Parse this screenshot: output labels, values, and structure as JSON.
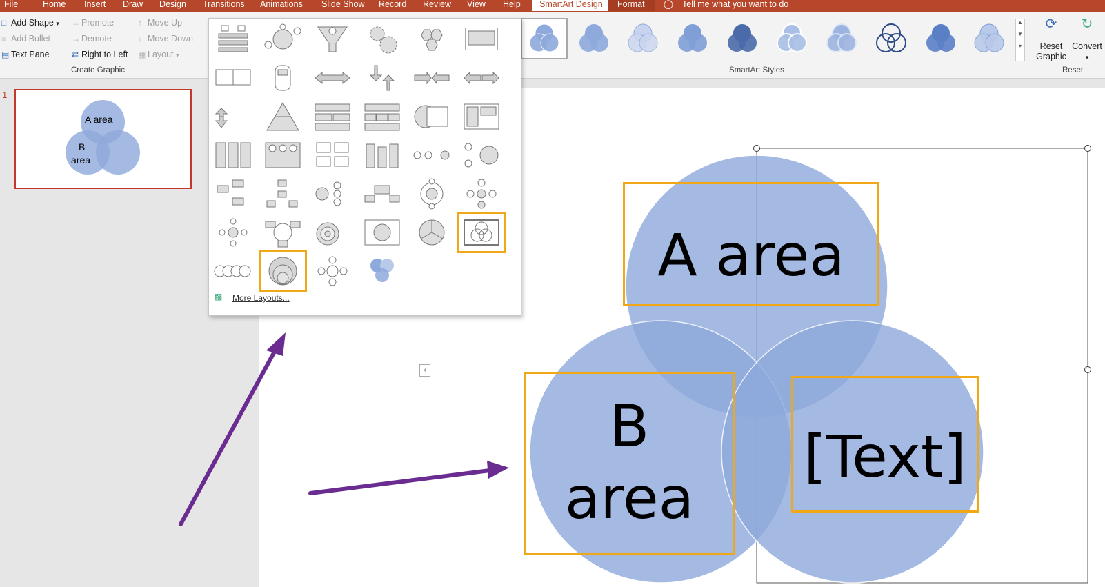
{
  "tabs": [
    "File",
    "Home",
    "Insert",
    "Draw",
    "Design",
    "Transitions",
    "Animations",
    "Slide Show",
    "Record",
    "Review",
    "View",
    "Help",
    "SmartArt Design",
    "Format"
  ],
  "tell_me": "Tell me what you want to do",
  "create_graphic": {
    "add_shape": "Add Shape",
    "add_bullet": "Add Bullet",
    "text_pane": "Text Pane",
    "promote": "Promote",
    "demote": "Demote",
    "right_to_left": "Right to Left",
    "move_up": "Move Up",
    "move_down": "Move Down",
    "layout": "Layout",
    "group_label": "Create Graphic"
  },
  "styles_group_label": "SmartArt Styles",
  "reset_group": {
    "reset_graphic_l1": "Reset",
    "reset_graphic_l2": "Graphic",
    "convert": "Convert",
    "group_label": "Reset"
  },
  "slide_number": "1",
  "thumbnail": {
    "a": "A area",
    "b1": "B",
    "b2": "area"
  },
  "layouts_menu": {
    "more_layouts": "More Layouts..."
  },
  "venn": {
    "a_label": "A area",
    "b_label_1": "B",
    "b_label_2": "area",
    "c_label": "[Text]"
  },
  "colors": {
    "accent": "#b7472a",
    "highlight": "#f0a818",
    "circle_fill": "#8ea9db",
    "arrow": "#6b2c91"
  }
}
